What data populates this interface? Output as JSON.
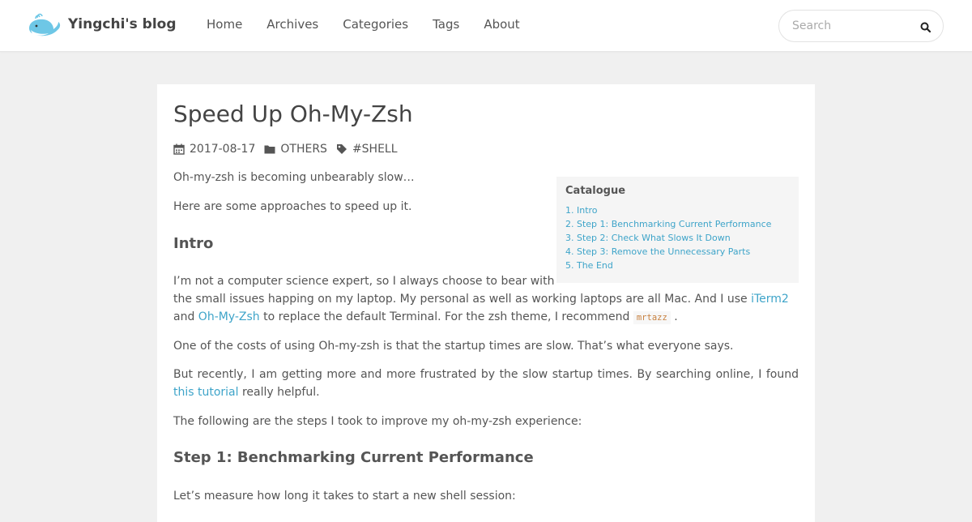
{
  "header": {
    "site_name": "Yingchi's blog",
    "nav": [
      "Home",
      "Archives",
      "Categories",
      "Tags",
      "About"
    ],
    "search_placeholder": "Search"
  },
  "post": {
    "title": "Speed Up Oh-My-Zsh",
    "date": "2017-08-17",
    "category": "OTHERS",
    "tag": "#SHELL",
    "p1": "Oh-my-zsh is becoming unbearably slow…",
    "p2": "Here are some approaches to speed up it.",
    "h_intro": "Intro",
    "p3_line1": "I’m not a computer science expert, so I always choose to bear with",
    "p3_line2_a": "the small issues happing on my laptop. My personal as well as working laptops are all Mac. And I use ",
    "p3_link1": "iTerm2",
    "p3_line3_a": "and ",
    "p3_link2": "Oh-My-Zsh",
    "p3_line3_b": " to replace the default Terminal. For the zsh theme, I recommend ",
    "p3_code": "mrtazz",
    "p3_line3_c": " .",
    "p4": "One of the costs of using Oh-my-zsh is that the startup times are slow. That’s what everyone says.",
    "p5_a": "But recently, I am getting more and more frustrated by the slow startup times. By searching online, I found ",
    "p5_link": "this tutorial",
    "p5_b": " really helpful.",
    "p6": "The following are the steps I took to improve my oh-my-zsh experience:",
    "h_step1": "Step 1: Benchmarking Current Performance",
    "p7": "Let’s measure how long it takes to start a new shell session:"
  },
  "toc": {
    "title": "Catalogue",
    "items": [
      "1. Intro",
      "2. Step 1: Benchmarking Current Performance",
      "3. Step 2: Check What Slows It Down",
      "4. Step 3: Remove the Unnecessary Parts",
      "5. The End"
    ]
  },
  "colors": {
    "link": "#3ea4c9",
    "code": "#c7803f",
    "background": "#f0f0f0"
  }
}
